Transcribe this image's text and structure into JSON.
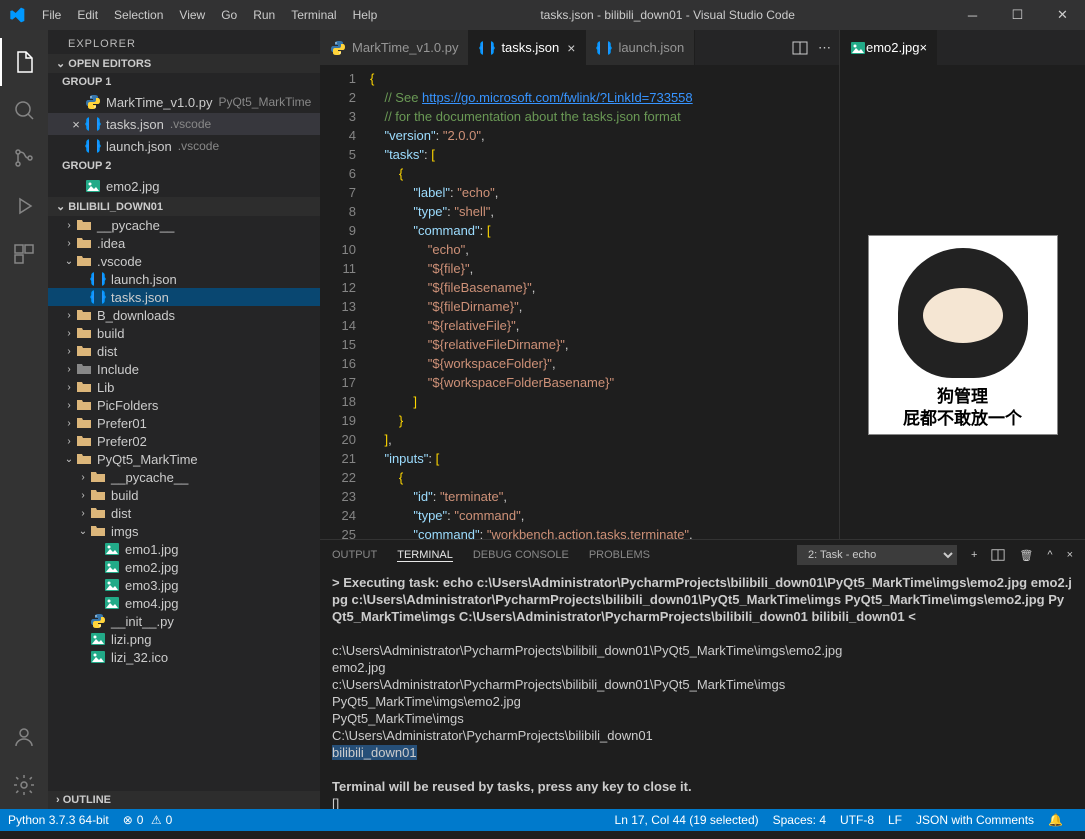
{
  "title": "tasks.json - bilibili_down01 - Visual Studio Code",
  "menu": [
    "File",
    "Edit",
    "Selection",
    "View",
    "Go",
    "Run",
    "Terminal",
    "Help"
  ],
  "sidebar": {
    "title": "EXPLORER",
    "sections": {
      "open_editors": "OPEN EDITORS",
      "group1": "GROUP 1",
      "group2": "GROUP 2",
      "project": "BILIBILI_DOWN01",
      "outline": "OUTLINE"
    },
    "open_editors": {
      "group1": [
        {
          "name": "MarkTime_v1.0.py",
          "dim": "PyQt5_MarkTime",
          "icon": "py"
        },
        {
          "name": "tasks.json",
          "dim": ".vscode",
          "icon": "json",
          "active": true,
          "close": true
        },
        {
          "name": "launch.json",
          "dim": ".vscode",
          "icon": "json"
        }
      ],
      "group2": [
        {
          "name": "emo2.jpg",
          "icon": "img"
        }
      ]
    },
    "tree": [
      {
        "d": 0,
        "chev": "r",
        "icon": "folder",
        "name": "__pycache__"
      },
      {
        "d": 0,
        "chev": "r",
        "icon": "folder",
        "name": ".idea"
      },
      {
        "d": 0,
        "chev": "d",
        "icon": "folder",
        "name": ".vscode"
      },
      {
        "d": 1,
        "icon": "json",
        "name": "launch.json"
      },
      {
        "d": 1,
        "icon": "json",
        "name": "tasks.json",
        "selected": true
      },
      {
        "d": 0,
        "chev": "r",
        "icon": "folder",
        "name": "B_downloads"
      },
      {
        "d": 0,
        "chev": "r",
        "icon": "folder",
        "name": "build"
      },
      {
        "d": 0,
        "chev": "r",
        "icon": "folder",
        "name": "dist"
      },
      {
        "d": 0,
        "chev": "r",
        "icon": "folder-c",
        "name": "Include"
      },
      {
        "d": 0,
        "chev": "r",
        "icon": "folder",
        "name": "Lib"
      },
      {
        "d": 0,
        "chev": "r",
        "icon": "folder",
        "name": "PicFolders"
      },
      {
        "d": 0,
        "chev": "r",
        "icon": "folder",
        "name": "Prefer01"
      },
      {
        "d": 0,
        "chev": "r",
        "icon": "folder",
        "name": "Prefer02"
      },
      {
        "d": 0,
        "chev": "d",
        "icon": "folder",
        "name": "PyQt5_MarkTime"
      },
      {
        "d": 1,
        "chev": "r",
        "icon": "folder",
        "name": "__pycache__"
      },
      {
        "d": 1,
        "chev": "r",
        "icon": "folder",
        "name": "build"
      },
      {
        "d": 1,
        "chev": "r",
        "icon": "folder",
        "name": "dist"
      },
      {
        "d": 1,
        "chev": "d",
        "icon": "folder",
        "name": "imgs"
      },
      {
        "d": 2,
        "icon": "img",
        "name": "emo1.jpg"
      },
      {
        "d": 2,
        "icon": "img",
        "name": "emo2.jpg"
      },
      {
        "d": 2,
        "icon": "img",
        "name": "emo3.jpg"
      },
      {
        "d": 2,
        "icon": "img",
        "name": "emo4.jpg"
      },
      {
        "d": 1,
        "icon": "py",
        "name": "__init__.py"
      },
      {
        "d": 1,
        "icon": "img",
        "name": "lizi.png"
      },
      {
        "d": 1,
        "icon": "img",
        "name": "lizi_32.ico"
      }
    ]
  },
  "tabs": {
    "group1": [
      {
        "name": "MarkTime_v1.0.py",
        "icon": "py"
      },
      {
        "name": "tasks.json",
        "icon": "json",
        "active": true
      },
      {
        "name": "launch.json",
        "icon": "json"
      }
    ],
    "group2": [
      {
        "name": "emo2.jpg",
        "icon": "img",
        "active": true
      }
    ]
  },
  "preview": {
    "caption1": "狗管理",
    "caption2": "屁都不敢放一个"
  },
  "code": {
    "lines": [
      1,
      2,
      3,
      4,
      5,
      6,
      7,
      8,
      9,
      10,
      11,
      12,
      13,
      14,
      15,
      16,
      17,
      18,
      19,
      20,
      21,
      22,
      23,
      24,
      25
    ],
    "link": "https://go.microsoft.com/fwlink/?LinkId=733558",
    "comment2": "// for the documentation about the tasks.json format",
    "version_k": "\"version\"",
    "version_v": "\"2.0.0\"",
    "tasks_k": "\"tasks\"",
    "label_k": "\"label\"",
    "label_v": "\"echo\"",
    "type_k": "\"type\"",
    "type_v": "\"shell\"",
    "command_k": "\"command\"",
    "arr": [
      "\"echo\"",
      "\"${file}\"",
      "\"${fileBasename}\"",
      "\"${fileDirname}\"",
      "\"${relativeFile}\"",
      "\"${relativeFileDirname}\"",
      "\"${workspaceFolder}\"",
      "\"${workspaceFolderBasename}\""
    ],
    "inputs_k": "\"inputs\"",
    "id_k": "\"id\"",
    "id_v": "\"terminate\"",
    "itype_v": "\"command\"",
    "icmd_v": "\"workbench.action.tasks.terminate\""
  },
  "panel": {
    "tabs": [
      "OUTPUT",
      "TERMINAL",
      "DEBUG CONSOLE",
      "PROBLEMS"
    ],
    "active": "TERMINAL",
    "dropdown": "2: Task - echo",
    "term_lines": [
      {
        "b": true,
        "t": "> Executing task: echo c:\\Users\\Administrator\\PycharmProjects\\bilibili_down01\\PyQt5_MarkTime\\imgs\\emo2.jpg emo2.jpg c:\\Users\\Administrator\\PycharmProjects\\bilibili_down01\\PyQt5_MarkTime\\imgs PyQt5_MarkTime\\imgs\\emo2.jpg PyQt5_MarkTime\\imgs C:\\Users\\Administrator\\PycharmProjects\\bilibili_down01 bilibili_down01 <"
      },
      {
        "t": ""
      },
      {
        "t": "c:\\Users\\Administrator\\PycharmProjects\\bilibili_down01\\PyQt5_MarkTime\\imgs\\emo2.jpg"
      },
      {
        "t": "emo2.jpg"
      },
      {
        "t": "c:\\Users\\Administrator\\PycharmProjects\\bilibili_down01\\PyQt5_MarkTime\\imgs"
      },
      {
        "t": "PyQt5_MarkTime\\imgs\\emo2.jpg"
      },
      {
        "t": "PyQt5_MarkTime\\imgs"
      },
      {
        "t": "C:\\Users\\Administrator\\PycharmProjects\\bilibili_down01"
      },
      {
        "hl": true,
        "t": "bilibili_down01"
      },
      {
        "t": ""
      },
      {
        "b": true,
        "t": "Terminal will be reused by tasks, press any key to close it."
      },
      {
        "t": "[]"
      }
    ]
  },
  "status": {
    "python": "Python 3.7.3 64-bit",
    "errors": "0",
    "warnings": "0",
    "lncol": "Ln 17, Col 44 (19 selected)",
    "spaces": "Spaces: 4",
    "enc": "UTF-8",
    "eol": "LF",
    "lang": "JSON with Comments"
  }
}
